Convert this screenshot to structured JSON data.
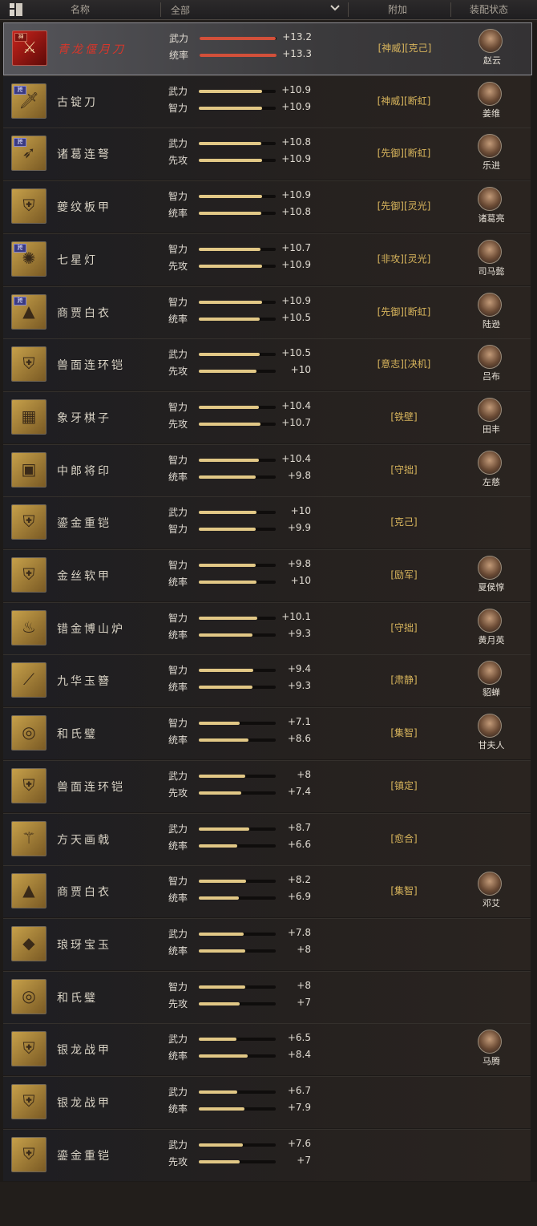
{
  "header": {
    "name_label": "名称",
    "filter_value": "全部",
    "extra_label": "附加",
    "status_label": "装配状态"
  },
  "colors": {
    "bar_normal": "#e2c886",
    "bar_selected": "#d2503a",
    "extra_text": "#d7b45c",
    "selected_name": "#d8362a"
  },
  "bar_max": 13.3,
  "items": [
    {
      "tag": "神",
      "icon": "blade-icon",
      "name": "青龙偃月刀",
      "selected": true,
      "s1": {
        "label": "武力",
        "value": "+13.2",
        "num": 13.2
      },
      "s2": {
        "label": "统率",
        "value": "+13.3",
        "num": 13.3
      },
      "extra": "[神威][克己]",
      "hero": "赵云"
    },
    {
      "tag": "跨",
      "icon": "saber-icon",
      "name": "古锭刀",
      "s1": {
        "label": "武力",
        "value": "+10.9",
        "num": 10.9
      },
      "s2": {
        "label": "智力",
        "value": "+10.9",
        "num": 10.9
      },
      "extra": "[神威][断虹]",
      "hero": "姜维"
    },
    {
      "tag": "跨",
      "icon": "crossbow-icon",
      "name": "诸葛连弩",
      "s1": {
        "label": "武力",
        "value": "+10.8",
        "num": 10.8
      },
      "s2": {
        "label": "先攻",
        "value": "+10.9",
        "num": 10.9
      },
      "extra": "[先御][断虹]",
      "hero": "乐进"
    },
    {
      "tag": "",
      "icon": "armor-icon",
      "name": "夔纹板甲",
      "s1": {
        "label": "智力",
        "value": "+10.9",
        "num": 10.9
      },
      "s2": {
        "label": "统率",
        "value": "+10.8",
        "num": 10.8
      },
      "extra": "[先御][灵光]",
      "hero": "诸葛亮"
    },
    {
      "tag": "跨",
      "icon": "lamp-icon",
      "name": "七星灯",
      "s1": {
        "label": "智力",
        "value": "+10.7",
        "num": 10.7
      },
      "s2": {
        "label": "先攻",
        "value": "+10.9",
        "num": 10.9
      },
      "extra": "[非攻][灵光]",
      "hero": "司马懿"
    },
    {
      "tag": "跨",
      "icon": "robe-icon",
      "name": "商贾白衣",
      "s1": {
        "label": "智力",
        "value": "+10.9",
        "num": 10.9
      },
      "s2": {
        "label": "统率",
        "value": "+10.5",
        "num": 10.5
      },
      "extra": "[先御][断虹]",
      "hero": "陆逊"
    },
    {
      "tag": "",
      "icon": "armor-icon",
      "name": "兽面连环铠",
      "s1": {
        "label": "武力",
        "value": "+10.5",
        "num": 10.5
      },
      "s2": {
        "label": "先攻",
        "value": "+10",
        "num": 10
      },
      "extra": "[意志][决机]",
      "hero": "吕布"
    },
    {
      "tag": "",
      "icon": "chess-icon",
      "name": "象牙棋子",
      "s1": {
        "label": "智力",
        "value": "+10.4",
        "num": 10.4
      },
      "s2": {
        "label": "先攻",
        "value": "+10.7",
        "num": 10.7
      },
      "extra": "[铁壁]",
      "hero": "田丰"
    },
    {
      "tag": "",
      "icon": "seal-icon",
      "name": "中郎将印",
      "s1": {
        "label": "智力",
        "value": "+10.4",
        "num": 10.4
      },
      "s2": {
        "label": "统率",
        "value": "+9.8",
        "num": 9.8
      },
      "extra": "[守拙]",
      "hero": "左慈"
    },
    {
      "tag": "",
      "icon": "armor-icon",
      "name": "鎏金重铠",
      "s1": {
        "label": "武力",
        "value": "+10",
        "num": 10
      },
      "s2": {
        "label": "智力",
        "value": "+9.9",
        "num": 9.9
      },
      "extra": "[克己]",
      "hero": ""
    },
    {
      "tag": "",
      "icon": "golden-armor-icon",
      "name": "金丝软甲",
      "s1": {
        "label": "智力",
        "value": "+9.8",
        "num": 9.8
      },
      "s2": {
        "label": "统率",
        "value": "+10",
        "num": 10
      },
      "extra": "[励军]",
      "hero": "夏侯惇"
    },
    {
      "tag": "",
      "icon": "censer-icon",
      "name": "错金博山炉",
      "s1": {
        "label": "智力",
        "value": "+10.1",
        "num": 10.1
      },
      "s2": {
        "label": "统率",
        "value": "+9.3",
        "num": 9.3
      },
      "extra": "[守拙]",
      "hero": "黄月英"
    },
    {
      "tag": "",
      "icon": "hairpin-icon",
      "name": "九华玉簪",
      "s1": {
        "label": "智力",
        "value": "+9.4",
        "num": 9.4
      },
      "s2": {
        "label": "统率",
        "value": "+9.3",
        "num": 9.3
      },
      "extra": "[肃静]",
      "hero": "貂蝉"
    },
    {
      "tag": "",
      "icon": "jade-disc-icon",
      "name": "和氏璧",
      "s1": {
        "label": "智力",
        "value": "+7.1",
        "num": 7.1
      },
      "s2": {
        "label": "统率",
        "value": "+8.6",
        "num": 8.6
      },
      "extra": "[集智]",
      "hero": "甘夫人"
    },
    {
      "tag": "",
      "icon": "armor-icon",
      "name": "兽面连环铠",
      "s1": {
        "label": "武力",
        "value": "+8",
        "num": 8
      },
      "s2": {
        "label": "先攻",
        "value": "+7.4",
        "num": 7.4
      },
      "extra": "[镇定]",
      "hero": ""
    },
    {
      "tag": "",
      "icon": "halberd-icon",
      "name": "方天画戟",
      "s1": {
        "label": "武力",
        "value": "+8.7",
        "num": 8.7
      },
      "s2": {
        "label": "统率",
        "value": "+6.6",
        "num": 6.6
      },
      "extra": "[愈合]",
      "hero": ""
    },
    {
      "tag": "",
      "icon": "robe-icon",
      "name": "商贾白衣",
      "s1": {
        "label": "智力",
        "value": "+8.2",
        "num": 8.2
      },
      "s2": {
        "label": "统率",
        "value": "+6.9",
        "num": 6.9
      },
      "extra": "[集智]",
      "hero": "邓艾"
    },
    {
      "tag": "",
      "icon": "jade-icon",
      "name": "琅玡宝玉",
      "s1": {
        "label": "武力",
        "value": "+7.8",
        "num": 7.8
      },
      "s2": {
        "label": "统率",
        "value": "+8",
        "num": 8
      },
      "extra": "",
      "hero": ""
    },
    {
      "tag": "",
      "icon": "jade-disc-icon",
      "name": "和氏璧",
      "s1": {
        "label": "智力",
        "value": "+8",
        "num": 8
      },
      "s2": {
        "label": "先攻",
        "value": "+7",
        "num": 7
      },
      "extra": "",
      "hero": ""
    },
    {
      "tag": "",
      "icon": "silver-armor-icon",
      "name": "银龙战甲",
      "s1": {
        "label": "武力",
        "value": "+6.5",
        "num": 6.5
      },
      "s2": {
        "label": "统率",
        "value": "+8.4",
        "num": 8.4
      },
      "extra": "",
      "hero": "马腾"
    },
    {
      "tag": "",
      "icon": "silver-armor-icon",
      "name": "银龙战甲",
      "s1": {
        "label": "武力",
        "value": "+6.7",
        "num": 6.7
      },
      "s2": {
        "label": "统率",
        "value": "+7.9",
        "num": 7.9
      },
      "extra": "",
      "hero": ""
    },
    {
      "tag": "",
      "icon": "armor-icon",
      "name": "鎏金重铠",
      "s1": {
        "label": "武力",
        "value": "+7.6",
        "num": 7.6
      },
      "s2": {
        "label": "先攻",
        "value": "+7",
        "num": 7
      },
      "extra": "",
      "hero": ""
    }
  ]
}
